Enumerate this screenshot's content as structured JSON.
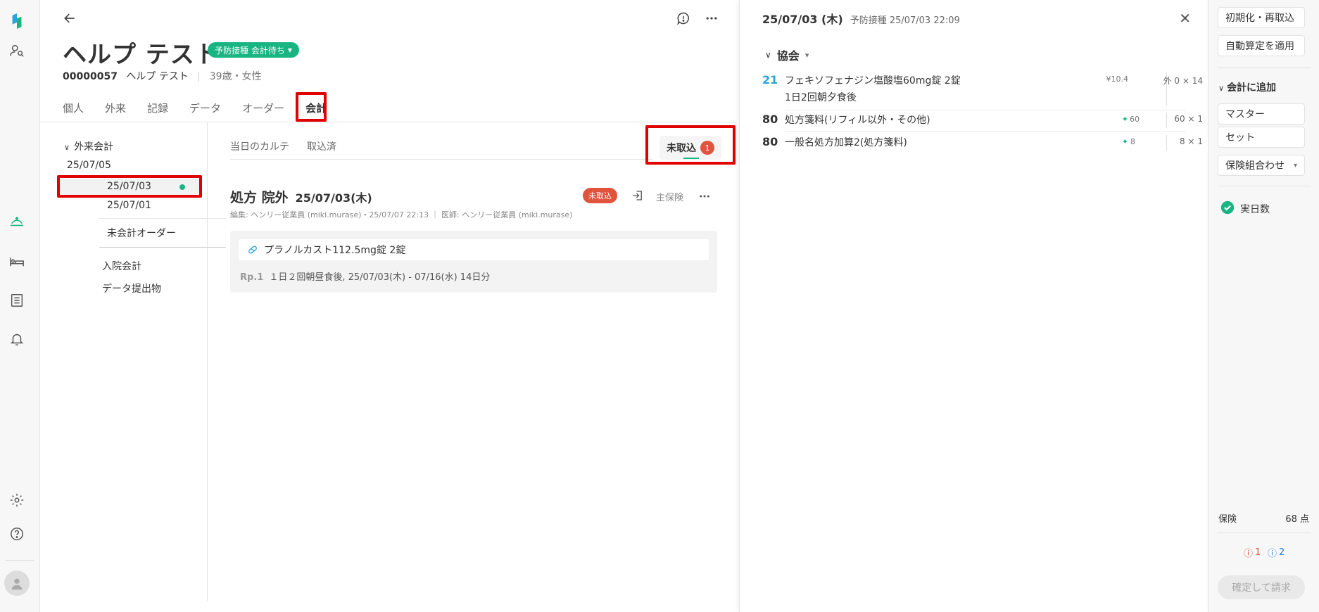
{
  "rail": {
    "icons": [
      "logo-icon",
      "patient-search-icon",
      "reception-icon",
      "bed-icon",
      "list-icon",
      "bell-icon",
      "settings-icon",
      "help-icon",
      "avatar"
    ]
  },
  "patient": {
    "name": "ヘルプ テスト",
    "status": "予防接種 会計待ち",
    "id": "00000057",
    "name_small": "ヘルプ テスト",
    "age_gender": "39歳・女性"
  },
  "tabs": [
    "個人",
    "外来",
    "記録",
    "データ",
    "オーダー",
    "会計"
  ],
  "sub_nav": {
    "section": "外来会計",
    "dates": [
      "25/07/05",
      "25/07/03",
      "25/07/01"
    ],
    "unbilled": "未会計オーダー",
    "inpatient": "入院会計",
    "data_output": "データ提出物"
  },
  "content_tabs": [
    "当日のカルテ",
    "取込済"
  ],
  "uncaptured": {
    "label": "未取込",
    "count": "1"
  },
  "prescription": {
    "title": "処方 院外",
    "date": "25/07/03(木)",
    "status": "未取込",
    "insurance": "主保険",
    "meta": "編集: ヘンリー従業員 (miki.murase)・25/07/07 22:13 ｜ 医師: ヘンリー従業員 (miki.murase)",
    "drug": "プラノルカスト112.5mg錠  2錠",
    "rp_label": "Rp.1",
    "rp_text": "１日２回朝昼食後, 25/07/03(木) - 07/16(水) 14日分"
  },
  "detail": {
    "header_date": "25/07/03 (木)",
    "header_sub": "予防接種 25/07/03 22:09",
    "group": "協会",
    "items": [
      {
        "pts": "21",
        "name": "フェキソフェナジン塩酸塩60mg錠  2錠",
        "sub": "1日2回朝夕食後",
        "unit": "¥10.4",
        "mult": "外 0 × 14",
        "blue": true
      },
      {
        "pts": "80",
        "name": "処方箋料(リフィル以外・その他)",
        "unit": "60",
        "mult": "60 × 1",
        "blue": false
      },
      {
        "pts": "80",
        "name": "一般名処方加算2(処方箋料)",
        "unit": "8",
        "mult": "8 × 1",
        "blue": false
      }
    ]
  },
  "side": {
    "reset": "初期化・再取込",
    "auto": "自動算定を適用",
    "add_section": "会計に追加",
    "master": "マスター",
    "set": "セット",
    "insurance_combo": "保険組合わせ",
    "actual_days": "実日数",
    "insurance_label": "保険",
    "insurance_points": "68 点",
    "error_count": "1",
    "info_count": "2",
    "confirm": "確定して請求"
  },
  "colors": {
    "accent": "#18b583",
    "danger": "#e0533d",
    "highlight": "#e00000",
    "info": "#2aa5d8"
  }
}
